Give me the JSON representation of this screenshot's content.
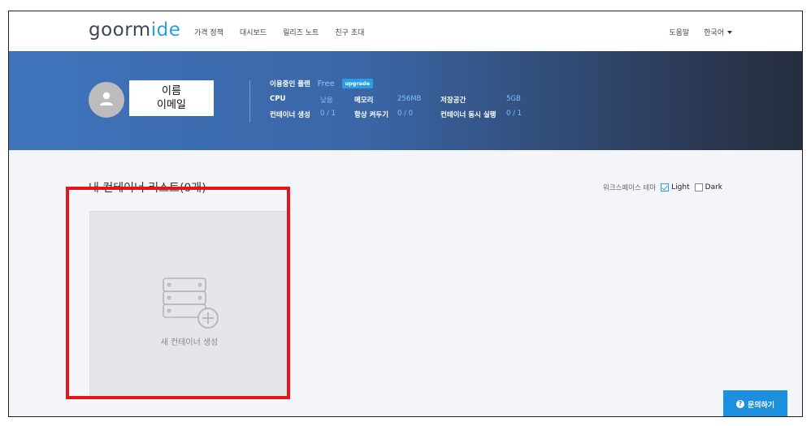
{
  "nav": {
    "logo_goorm": "goorm",
    "logo_ide": "ide",
    "links": [
      "가격 정책",
      "대시보드",
      "릴리즈 노트",
      "친구 초대"
    ],
    "help": "도움말",
    "language": "한국어"
  },
  "profile": {
    "name": "이름",
    "email": "이메일"
  },
  "plan": {
    "label": "이용중인 플랜",
    "value": "Free",
    "upgrade": "upgrade",
    "cpu_label": "CPU",
    "cpu_value": "낮음",
    "memory_label": "메모리",
    "memory_value": "256MB",
    "storage_label": "저장공간",
    "storage_value": "5GB",
    "containers_label": "컨테이너 생성",
    "containers_value": "0 / 1",
    "alwayson_label": "항상 켜두기",
    "alwayson_value": "0 / 0",
    "concurrent_label": "컨테이너 동시 실행",
    "concurrent_value": "0 / 1"
  },
  "main": {
    "title": "내 컨테이너 리스트(0개)",
    "theme_label": "워크스페이스 테마",
    "theme_light": "Light",
    "theme_dark": "Dark",
    "theme_selected": "Light",
    "new_container": "새 컨테이너 생성"
  },
  "inquiry": {
    "label": "문의하기",
    "icon": "?"
  },
  "colors": {
    "accent": "#2a9ee4",
    "highlight_border": "#e2161b"
  }
}
